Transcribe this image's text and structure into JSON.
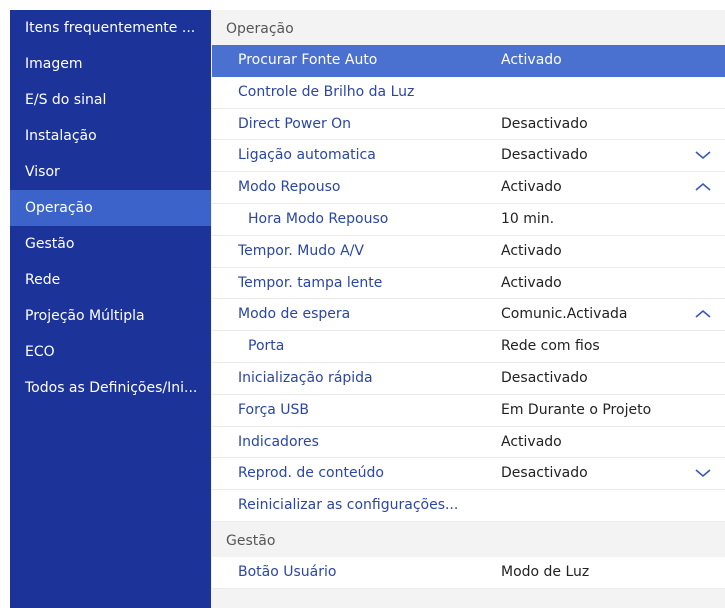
{
  "sidebar": {
    "items": [
      {
        "label": "Itens frequentemente ..."
      },
      {
        "label": "Imagem"
      },
      {
        "label": "E/S do sinal"
      },
      {
        "label": "Instalação"
      },
      {
        "label": "Visor"
      },
      {
        "label": "Operação"
      },
      {
        "label": "Gestão"
      },
      {
        "label": "Rede"
      },
      {
        "label": "Projeção Múltipla"
      },
      {
        "label": "ECO"
      },
      {
        "label": "Todos as Definições/Ini..."
      }
    ],
    "active_index": 5
  },
  "main": {
    "section1_title": "Operação",
    "rows": [
      {
        "label": "Procurar Fonte Auto",
        "value": "Activado"
      },
      {
        "label": "Controle de Brilho da Luz",
        "value": ""
      },
      {
        "label": "Direct Power On",
        "value": "Desactivado"
      },
      {
        "label": "Ligação automatica",
        "value": "Desactivado",
        "icon": "chevron-down-icon"
      },
      {
        "label": "Modo Repouso",
        "value": "Activado",
        "icon": "chevron-up-icon"
      },
      {
        "label": "Hora Modo Repouso",
        "value": "10 min."
      },
      {
        "label": "Tempor. Mudo A/V",
        "value": "Activado"
      },
      {
        "label": "Tempor. tampa lente",
        "value": "Activado"
      },
      {
        "label": "Modo de espera",
        "value": "Comunic.Activada",
        "icon": "chevron-up-icon"
      },
      {
        "label": "Porta",
        "value": "Rede com fios"
      },
      {
        "label": "Inicialização rápida",
        "value": "Desactivado"
      },
      {
        "label": "Força USB",
        "value": "Em Durante o Projeto"
      },
      {
        "label": "Indicadores",
        "value": "Activado"
      },
      {
        "label": "Reprod. de conteúdo",
        "value": "Desactivado",
        "icon": "chevron-down-icon"
      },
      {
        "label": "Reinicializar as configurações...",
        "value": ""
      }
    ],
    "section2_title": "Gestão",
    "rows2": [
      {
        "label": "Botão Usuário",
        "value": "Modo de Luz"
      }
    ]
  },
  "colors": {
    "sidebar_bg": "#1c339a",
    "sidebar_active": "#3c63c9",
    "row_highlight": "#4a70d0",
    "label_text": "#2b46a4"
  }
}
